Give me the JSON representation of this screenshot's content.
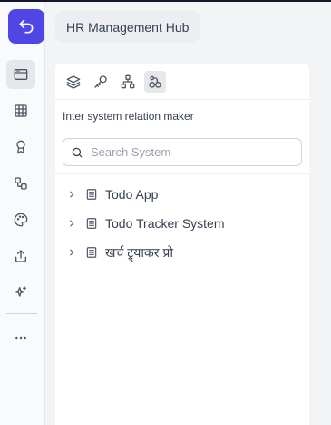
{
  "header": {
    "title": "HR Management Hub"
  },
  "sidebar": {
    "items": [
      {
        "name": "browser-icon",
        "active": true
      },
      {
        "name": "table-icon",
        "active": false
      },
      {
        "name": "award-icon",
        "active": false
      },
      {
        "name": "workflow-icon",
        "active": false
      },
      {
        "name": "palette-icon",
        "active": false
      },
      {
        "name": "upload-icon",
        "active": false
      },
      {
        "name": "sparkles-icon",
        "active": false
      },
      {
        "name": "more-icon",
        "active": false
      }
    ]
  },
  "panel": {
    "tabs": [
      {
        "name": "layers-icon",
        "active": false
      },
      {
        "name": "key-icon",
        "active": false
      },
      {
        "name": "hierarchy-icon",
        "active": false
      },
      {
        "name": "relations-icon",
        "active": true
      }
    ],
    "title": "Inter system relation maker",
    "search": {
      "placeholder": "Search System",
      "value": ""
    },
    "systems": [
      {
        "label": "Todo App"
      },
      {
        "label": "Todo Tracker System"
      },
      {
        "label": "खर्च ट्र्याकर प्रो"
      }
    ]
  },
  "colors": {
    "accent": "#4f46e5",
    "rail_active": "#e5e7eb",
    "background": "#f3f4f6"
  }
}
